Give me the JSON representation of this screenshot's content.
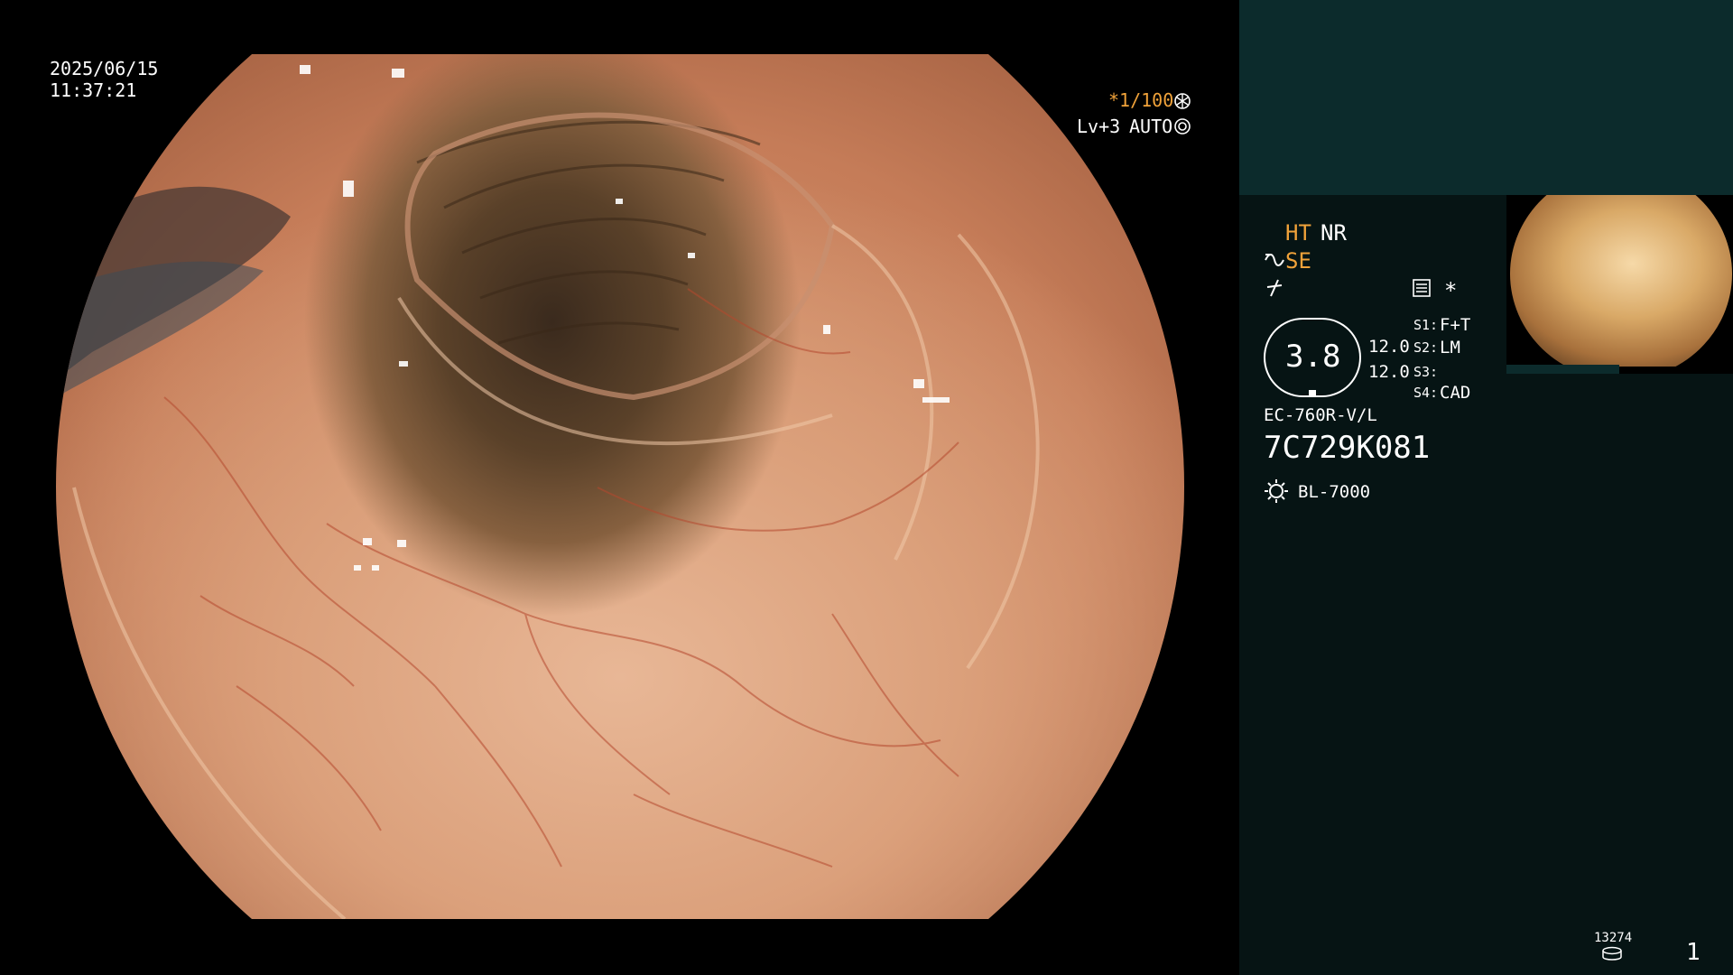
{
  "view": {
    "date": "2025/06/15",
    "time": "11:37:21",
    "shutter": "*1/100",
    "level": "Lv+3",
    "mode": "AUTO"
  },
  "panel": {
    "ht": "HT",
    "nr": "NR",
    "se": "SE",
    "gauge_value": "3.8",
    "value_1": "12.0",
    "value_2": "12.0",
    "s1_label": "S1:",
    "s1_value": "F+T",
    "s2_label": "S2:",
    "s2_value": "LM",
    "s3_label": "S3:",
    "s3_value": "",
    "s4_label": "S4:",
    "s4_value": "CAD",
    "scope_model": "EC-760R-V/L",
    "serial": "7C729K081",
    "light_source": "BL-7000",
    "asterisk": "*",
    "counter": "13274",
    "page_number": "1"
  },
  "icons": [
    "shutter-icon",
    "auto-icon",
    "wave-icon",
    "lightning-icon",
    "settings-icon",
    "lamp-icon",
    "storage-icon"
  ],
  "colors": {
    "accent_orange": "#f0a23a",
    "panel_bg": "#061414",
    "panel_top_bg": "#0c2b2c"
  }
}
